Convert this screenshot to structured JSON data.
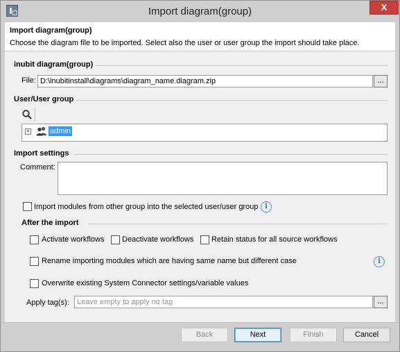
{
  "window": {
    "title": "Import diagram(group)",
    "close_glyph": "X"
  },
  "header": {
    "title": "Import diagram(group)",
    "description": "Choose the diagram file to be imported. Select also the user or user group the import should take place."
  },
  "diagram": {
    "section_title": "inubit diagram(group)",
    "file_label": "File:",
    "file_value": "D:\\inubitinstall\\diagrams\\diagram_name.diagram.zip",
    "browse_label": "..."
  },
  "user_group": {
    "section_title": "User/User group",
    "tree": [
      {
        "expander": "+",
        "icon": "users-icon",
        "label": "admin",
        "selected": true
      }
    ]
  },
  "import_settings": {
    "section_title": "Import settings",
    "comment_label": "Comment:",
    "comment_value": "",
    "import_modules_label": "Import modules from other group into the selected user/user group",
    "import_modules_checked": false
  },
  "after_import": {
    "section_title": "After the import",
    "activate_label": "Activate workflows",
    "deactivate_label": "Deactivate workflows",
    "retain_label": "Retain status for all source workflows",
    "rename_label": "Rename importing modules which are having same name but different case",
    "overwrite_label": "Overwrite existing System Connector settings/variable values",
    "apply_tags_label": "Apply tag(s):",
    "apply_tags_placeholder": "Leave empty to apply no tag",
    "browse_label": "..."
  },
  "info_glyph": "i",
  "buttons": {
    "back": "Back",
    "next": "Next",
    "finish": "Finish",
    "cancel": "Cancel"
  },
  "colors": {
    "selection": "#3399ff",
    "close_button": "#c7413a",
    "default_button_border": "#3c7fb1"
  }
}
